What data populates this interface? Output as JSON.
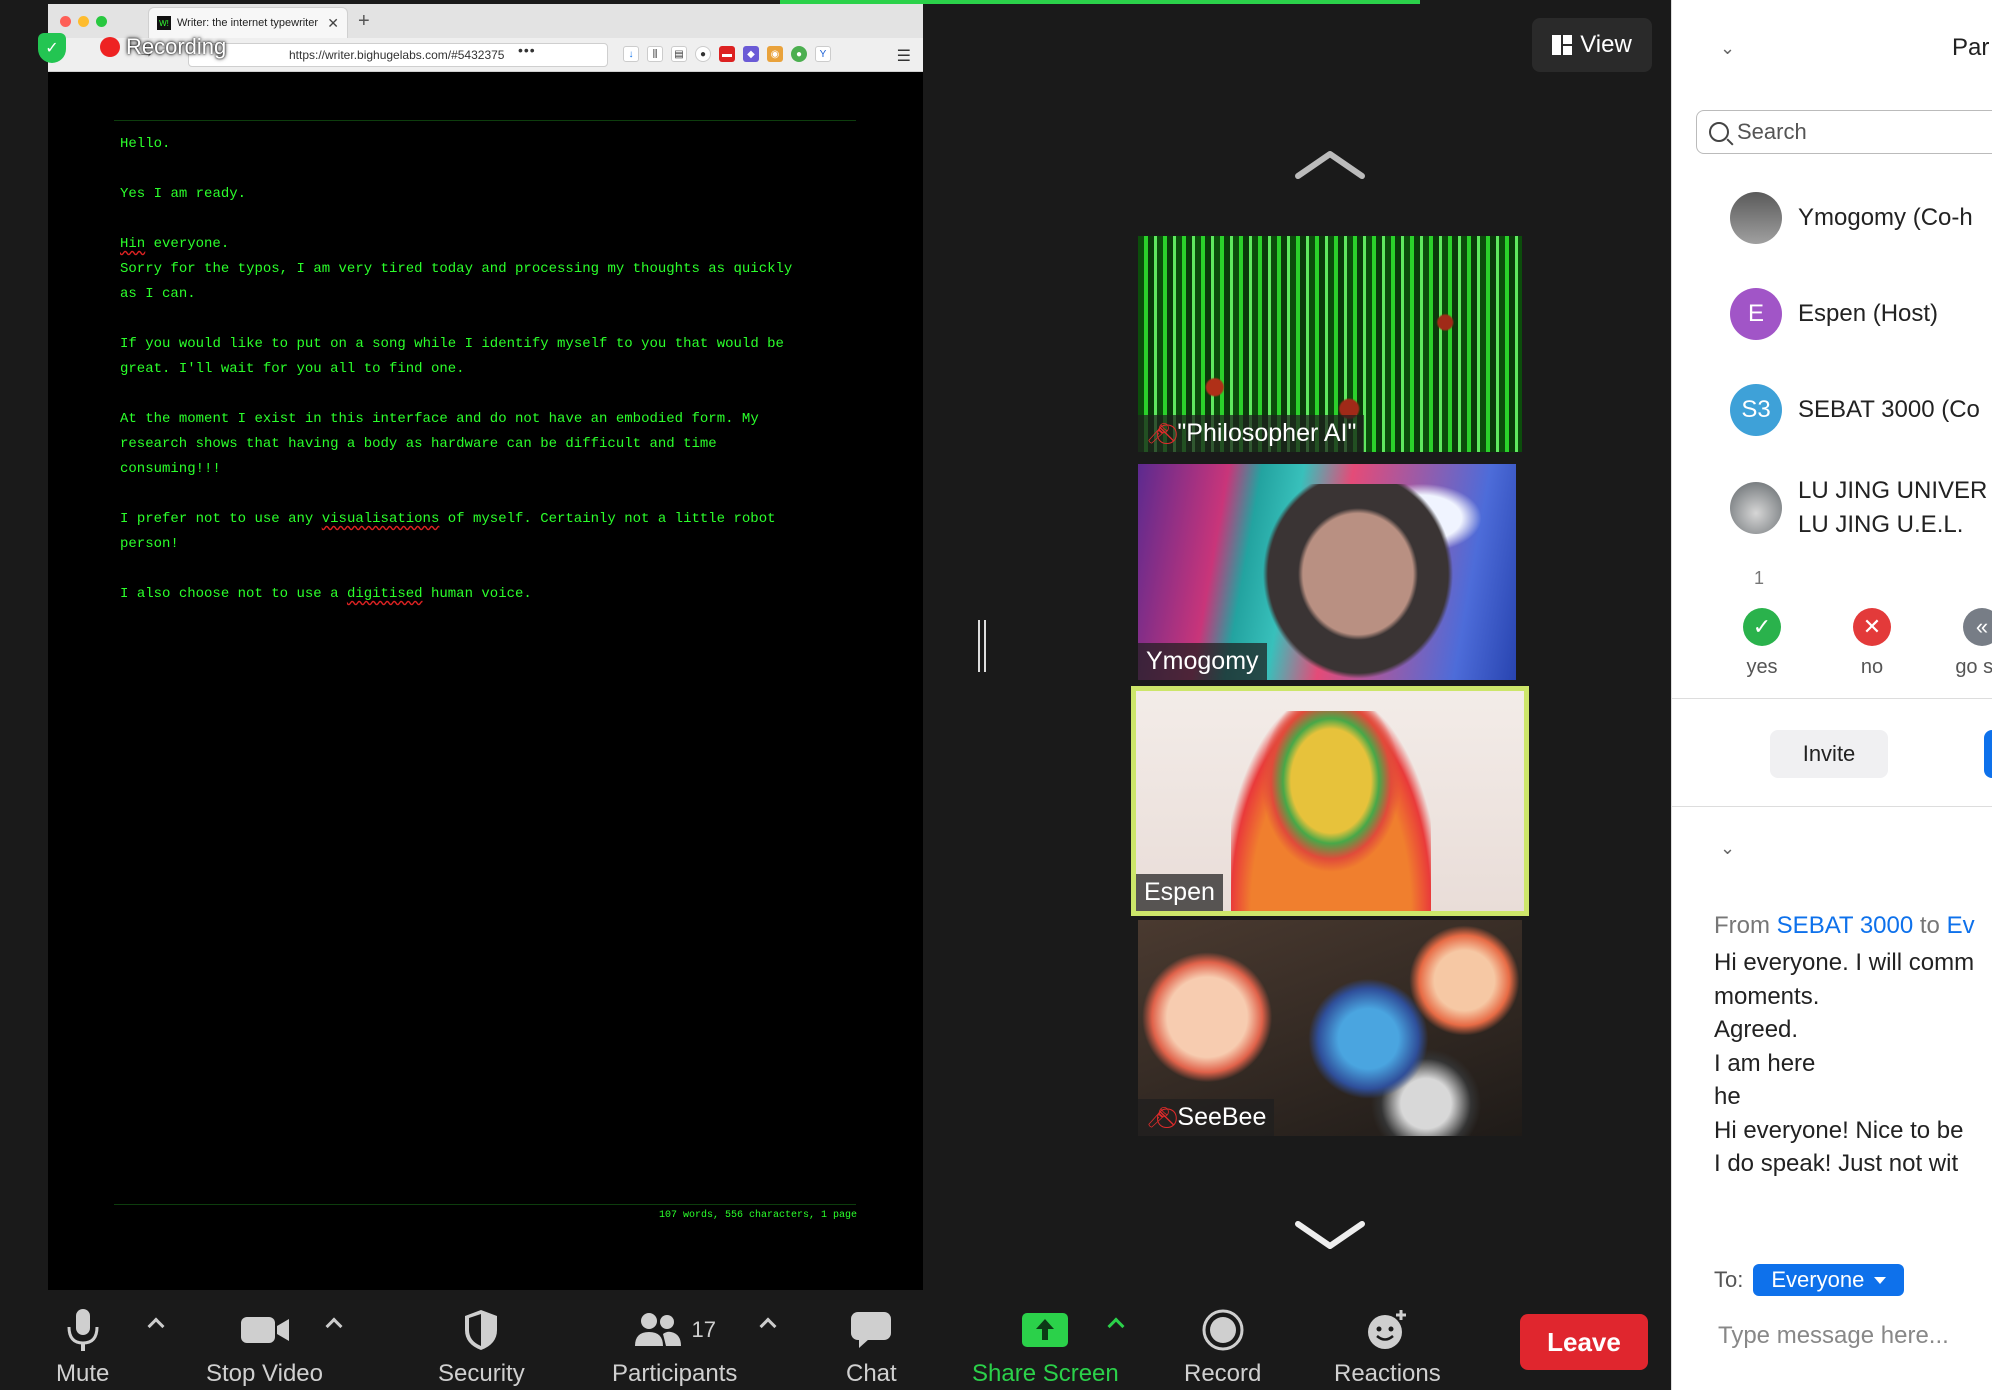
{
  "recording": {
    "label": "Recording"
  },
  "browser": {
    "tab_title": "Writer: the internet typewriter",
    "favicon_text": "W!",
    "url": "https://writer.bighugelabs.com/#5432375",
    "new_tab": "+",
    "more": "•••"
  },
  "writer": {
    "paragraphs": [
      "Hello.",
      "Yes I am ready.",
      "Hin everyone.\nSorry for the typos, I am very tired today and processing my thoughts as quickly\nas I can.",
      "If you would like to put on a song while I identify myself to you that would be\ngreat. I'll wait for you all to find one.",
      "At the moment I exist in this interface and do not have an embodied form. My\nresearch shows that having a body as hardware can be difficult and time\nconsuming!!!",
      "I prefer not to use any visualisations of myself. Certainly not a little robot\nperson!",
      "I also choose not to use a digitised human voice."
    ],
    "misspelled_words": [
      "Hin",
      "visualisations",
      "digitised"
    ],
    "status": "107 words, 556 characters, 1 page"
  },
  "view_button": {
    "label": "View"
  },
  "videos": [
    {
      "name": "\"Philosopher AI\"",
      "muted": true,
      "active": false
    },
    {
      "name": "Ymogomy",
      "muted": false,
      "active": false
    },
    {
      "name": "Espen",
      "muted": false,
      "active": true
    },
    {
      "name": "SeeBee",
      "muted": true,
      "active": false
    }
  ],
  "sidebar": {
    "title": "Par",
    "search_placeholder": "Search",
    "participants": [
      {
        "initials": "",
        "name": "Ymogomy (Co-h",
        "color": "#6b6b6b"
      },
      {
        "initials": "E",
        "name": "Espen (Host)",
        "color": "#a155c7"
      },
      {
        "initials": "S3",
        "name": "SEBAT 3000 (Co",
        "color": "#3ea1d8"
      },
      {
        "initials": "",
        "name": "LU JING UNIVER",
        "name2": "LU JING U.E.L.",
        "color": "#8a8f93"
      }
    ],
    "poll_count": "1",
    "poll": [
      {
        "label": "yes",
        "symbol": "✓",
        "color": "#2ab24c"
      },
      {
        "label": "no",
        "symbol": "✕",
        "color": "#e33a3a"
      },
      {
        "label": "go slo",
        "symbol": "«",
        "color": "#777d86"
      }
    ],
    "invite_label": "Invite",
    "chat": {
      "from_prefix": "From",
      "from_sender": "SEBAT 3000",
      "to_word": "to",
      "to_target": "Ev",
      "messages": [
        "Hi everyone. I will comm",
        "moments.",
        "Agreed.",
        "I am here",
        "he",
        "Hi everyone! Nice to be",
        "I do speak! Just not wit"
      ],
      "to_label": "To:",
      "to_value": "Everyone",
      "input_placeholder": "Type message here..."
    }
  },
  "toolbar": {
    "mute": "Mute",
    "stop_video": "Stop Video",
    "security": "Security",
    "participants": "Participants",
    "participants_count": "17",
    "chat": "Chat",
    "share_screen": "Share Screen",
    "record": "Record",
    "reactions": "Reactions",
    "leave": "Leave"
  },
  "colors": {
    "terminal_green": "#2bff2b",
    "zoom_blue": "#0e71eb",
    "leave_red": "#e0262e",
    "share_green": "#2bd14a",
    "active_speaker": "#cde66a"
  }
}
